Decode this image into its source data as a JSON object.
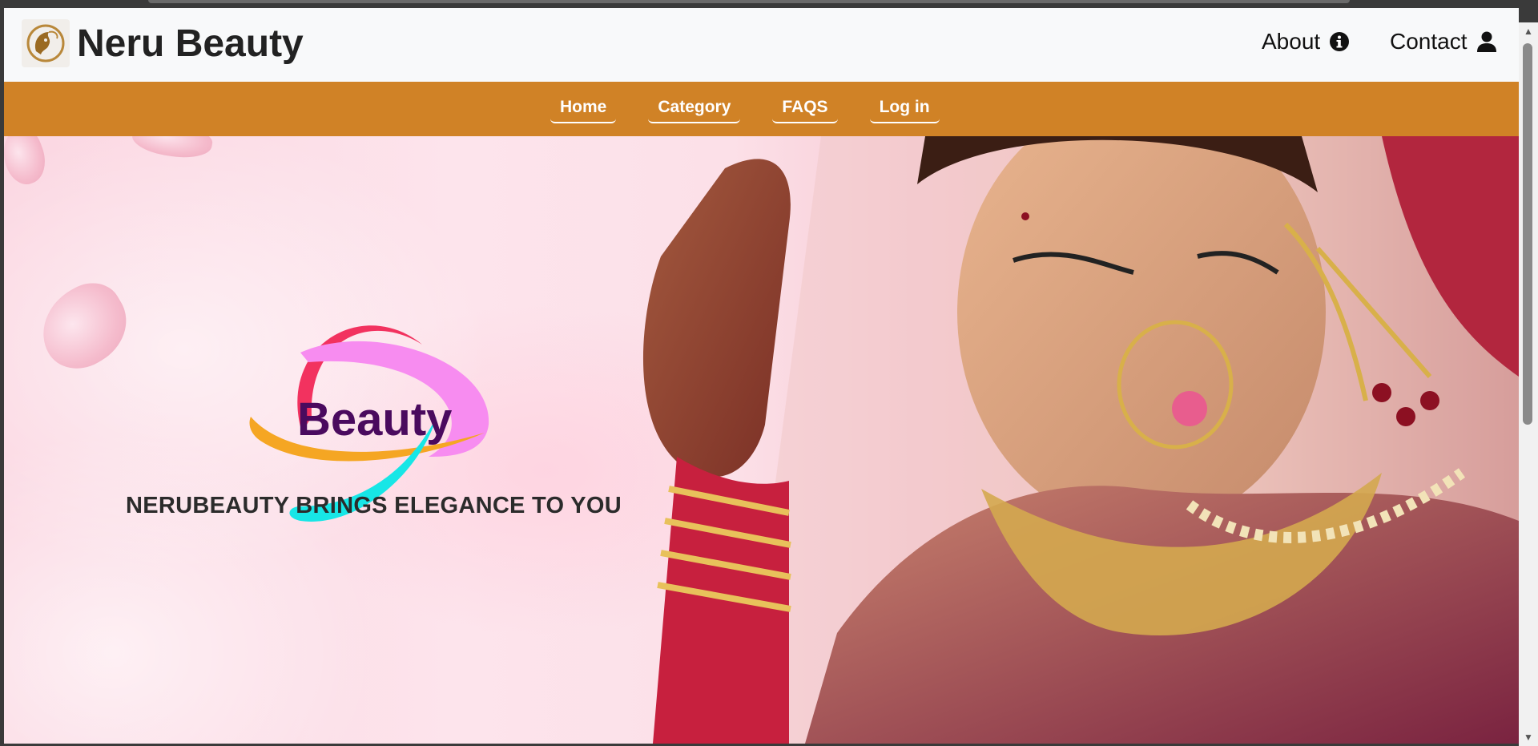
{
  "header": {
    "brand": "Neru Beauty",
    "about_label": "About",
    "contact_label": "Contact"
  },
  "menu": {
    "items": [
      {
        "label": "Home"
      },
      {
        "label": "Category"
      },
      {
        "label": "FAQS"
      },
      {
        "label": "Log in"
      }
    ]
  },
  "hero": {
    "logo_word": "Beauty",
    "tagline": "NERUBEAUTY BRINGS ELEGANCE TO YOU"
  },
  "colors": {
    "menu_bar": "#d08226",
    "header_bg": "#f8f9fa",
    "logo_word": "#4a0a5e",
    "swoosh_red": "#f2325f",
    "swoosh_pink": "#f78cf0",
    "swoosh_orange": "#f5a623",
    "swoosh_cyan": "#17e6e6"
  },
  "icons": {
    "about": "info-circle-icon",
    "contact": "user-icon",
    "logo": "gold-face-logo-icon"
  }
}
